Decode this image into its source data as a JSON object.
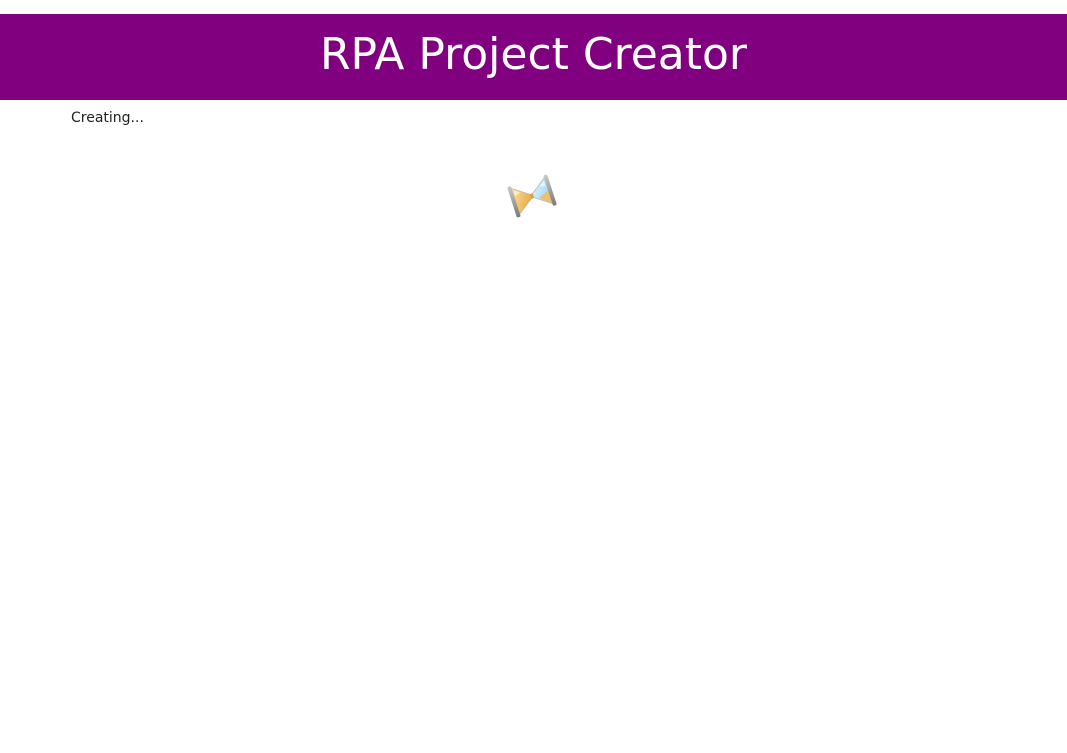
{
  "header": {
    "title": "RPA Project Creator",
    "background_color": "#800080",
    "text_color": "#ffffff"
  },
  "status": {
    "text": "Creating..."
  },
  "loading_indicator": {
    "icon": "hourglass-icon"
  }
}
